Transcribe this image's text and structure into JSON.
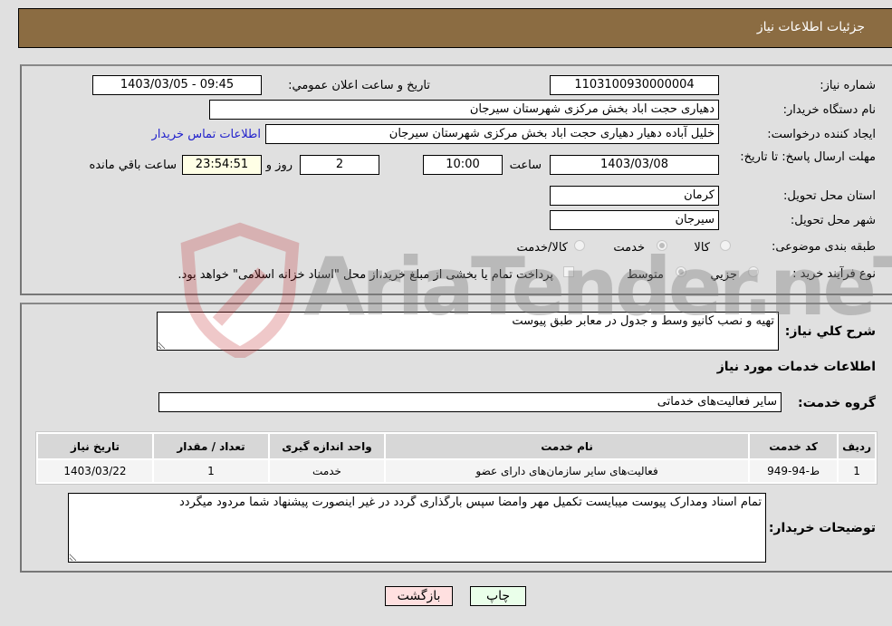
{
  "header": {
    "title": "جزئیات اطلاعات نیاز"
  },
  "fields": {
    "need_number": {
      "label": "شماره نیاز:",
      "value": "1103100930000004"
    },
    "announce_datetime": {
      "label": "تاریخ و ساعت اعلان عمومي:",
      "value": "1403/03/05 - 09:45"
    },
    "buyer_org": {
      "label": "نام دستگاه خریدار:",
      "value": "دهیاری حجت اباد بخش مرکزی شهرستان سیرجان"
    },
    "requester": {
      "label": "ایجاد کننده درخواست:",
      "value": "خلیل آباده دهیار دهیاری حجت اباد بخش مرکزی شهرستان سیرجان"
    },
    "buyer_contact_link": "اطلاعات تماس خریدار",
    "deadline": {
      "label": "مهلت ارسال پاسخ: تا تاریخ:",
      "date": "1403/03/08",
      "time_label": "ساعت",
      "time": "10:00",
      "days": "2",
      "days_label": "روز و",
      "remaining": "23:54:51",
      "remaining_label": "ساعت باقي مانده"
    },
    "province": {
      "label": "استان محل تحویل:",
      "value": "کرمان"
    },
    "city": {
      "label": "شهر محل تحویل:",
      "value": "سیرجان"
    },
    "category": {
      "label": "طبقه بندی موضوعی:",
      "options": [
        {
          "label": "کالا",
          "checked": false
        },
        {
          "label": "خدمت",
          "checked": true
        },
        {
          "label": "کالا/خدمت",
          "checked": false
        }
      ]
    },
    "purchase_process": {
      "label": "نوع فرآیند خرید :",
      "options": [
        {
          "label": "جزیي",
          "checked": false
        },
        {
          "label": "متوسط",
          "checked": true
        }
      ],
      "treasury_checkbox_label": "پرداخت تمام یا بخشی از مبلغ خرید،از محل \"اسناد خزانه اسلامی\" خواهد بود.",
      "treasury_checked": false
    }
  },
  "description": {
    "label": "شرح کلي نیاز:",
    "value": "تهیه و نصب کانیو وسط و جدول در معابر طبق پیوست"
  },
  "services_section": {
    "title": "اطلاعات خدمات مورد نیاز",
    "group_label": "گروه خدمت:",
    "group_value": "سایر فعالیت‌های خدماتی"
  },
  "table": {
    "headers": [
      "ردیف",
      "کد خدمت",
      "نام خدمت",
      "واحد اندازه گیری",
      "تعداد / مقدار",
      "تاریخ نیاز"
    ],
    "rows": [
      [
        "1",
        "ط-94-949",
        "فعالیت‌های سایر سازمان‌های دارای عضو",
        "خدمت",
        "1",
        "1403/03/22"
      ]
    ]
  },
  "buyer_notes": {
    "label": "توضیحات خریدار:",
    "value": "تمام اسناد ومدارک پیوست میبایست تکمیل مهر وامضا سپس بارگذاری گردد در غیر اینصورت پیشنهاد شما مردود میگردد"
  },
  "buttons": {
    "print": "چاپ",
    "back": "بازگشت"
  },
  "watermark": {
    "text": "AriaTender.neT"
  },
  "colors": {
    "header_bg": "#8b6c42",
    "print_bg": "#eaffea",
    "back_bg": "#ffe0e0",
    "remaining_bg": "#ffffe6",
    "link": "#2222cc"
  }
}
